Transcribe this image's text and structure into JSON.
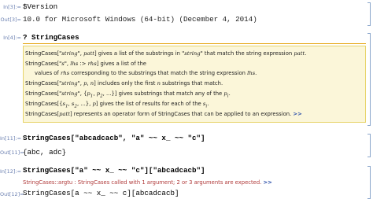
{
  "cells": {
    "in3_label": "In[3]:=",
    "in3_code": "$Version",
    "out3_label": "Out[3]=",
    "out3_text": "10.0 for Microsoft Windows (64-bit) (December 4, 2014)",
    "in4_label": "In[4]:=",
    "in4_code": "? StringCases",
    "doc": {
      "l1a": "StringCases[\"",
      "l1b": "string",
      "l1c": "\", ",
      "l1d": "patt",
      "l1e": "] gives a list of the substrings in \"",
      "l1f": "string",
      "l1g": "\" that match the string expression ",
      "l1h": "patt",
      "l1i": ".",
      "l2a": "StringCases[\"",
      "l2b": "s",
      "l2c": "\", ",
      "l2d": "lhs",
      "l2e": " :> ",
      "l2f": "rhs",
      "l2g": "] gives a list of the",
      "l3a": "values of ",
      "l3b": "rhs",
      "l3c": " corresponding to the substrings that match the string expression ",
      "l3d": "lhs",
      "l3e": ".",
      "l4a": "StringCases[\"",
      "l4b": "string",
      "l4c": "\", ",
      "l4d": "p",
      "l4e": ", ",
      "l4f": "n",
      "l4g": "] includes only the first ",
      "l4h": "n",
      "l4i": " substrings that match.",
      "l5a": "StringCases[\"",
      "l5b": "string",
      "l5c": "\", {",
      "l5d": "p",
      "l5e": "1",
      "l5f": ", ",
      "l5g": "p",
      "l5h": "2",
      "l5i": ", ...}] gives substrings that match any of the ",
      "l5j": "p",
      "l5k": "i",
      "l5l": ".",
      "l6a": "StringCases[{",
      "l6b": "s",
      "l6c": "1",
      "l6d": ", ",
      "l6e": "s",
      "l6f": "2",
      "l6g": ", ...}, ",
      "l6h": "p",
      "l6i": "] gives the list of results for each of the ",
      "l6j": "s",
      "l6k": "i",
      "l6l": ".",
      "l7a": "StringCases[",
      "l7b": "patt",
      "l7c": "] represents an operator form of StringCases that can be applied to an expression.",
      "more": ">>"
    },
    "in11_label": "In[11]:=",
    "in11_code": "StringCases[\"abcadcacb\", \"a\" ~~ x_ ~~ \"c\"]",
    "out11_label": "Out[11]=",
    "out11_text": "{abc, adc}",
    "in12_label": "In[12]:=",
    "in12_code": "StringCases[\"a\" ~~ x_ ~~ \"c\"][\"abcadcacb\"]",
    "msg_head": "StringCases::argtu",
    "msg_text": " : StringCases called with 1 argument; 2 or 3 arguments are expected.",
    "msg_more": ">>",
    "out12_label": "Out[12]=",
    "out12_text": "StringCases[a ~~ x_ ~~ c][abcadcacb]"
  },
  "colors": {
    "label": "#6a7fb0",
    "info_bg": "#fbf6d9",
    "info_border": "#e7d46a",
    "message": "#b03a3a",
    "link": "#2a4ea8"
  }
}
